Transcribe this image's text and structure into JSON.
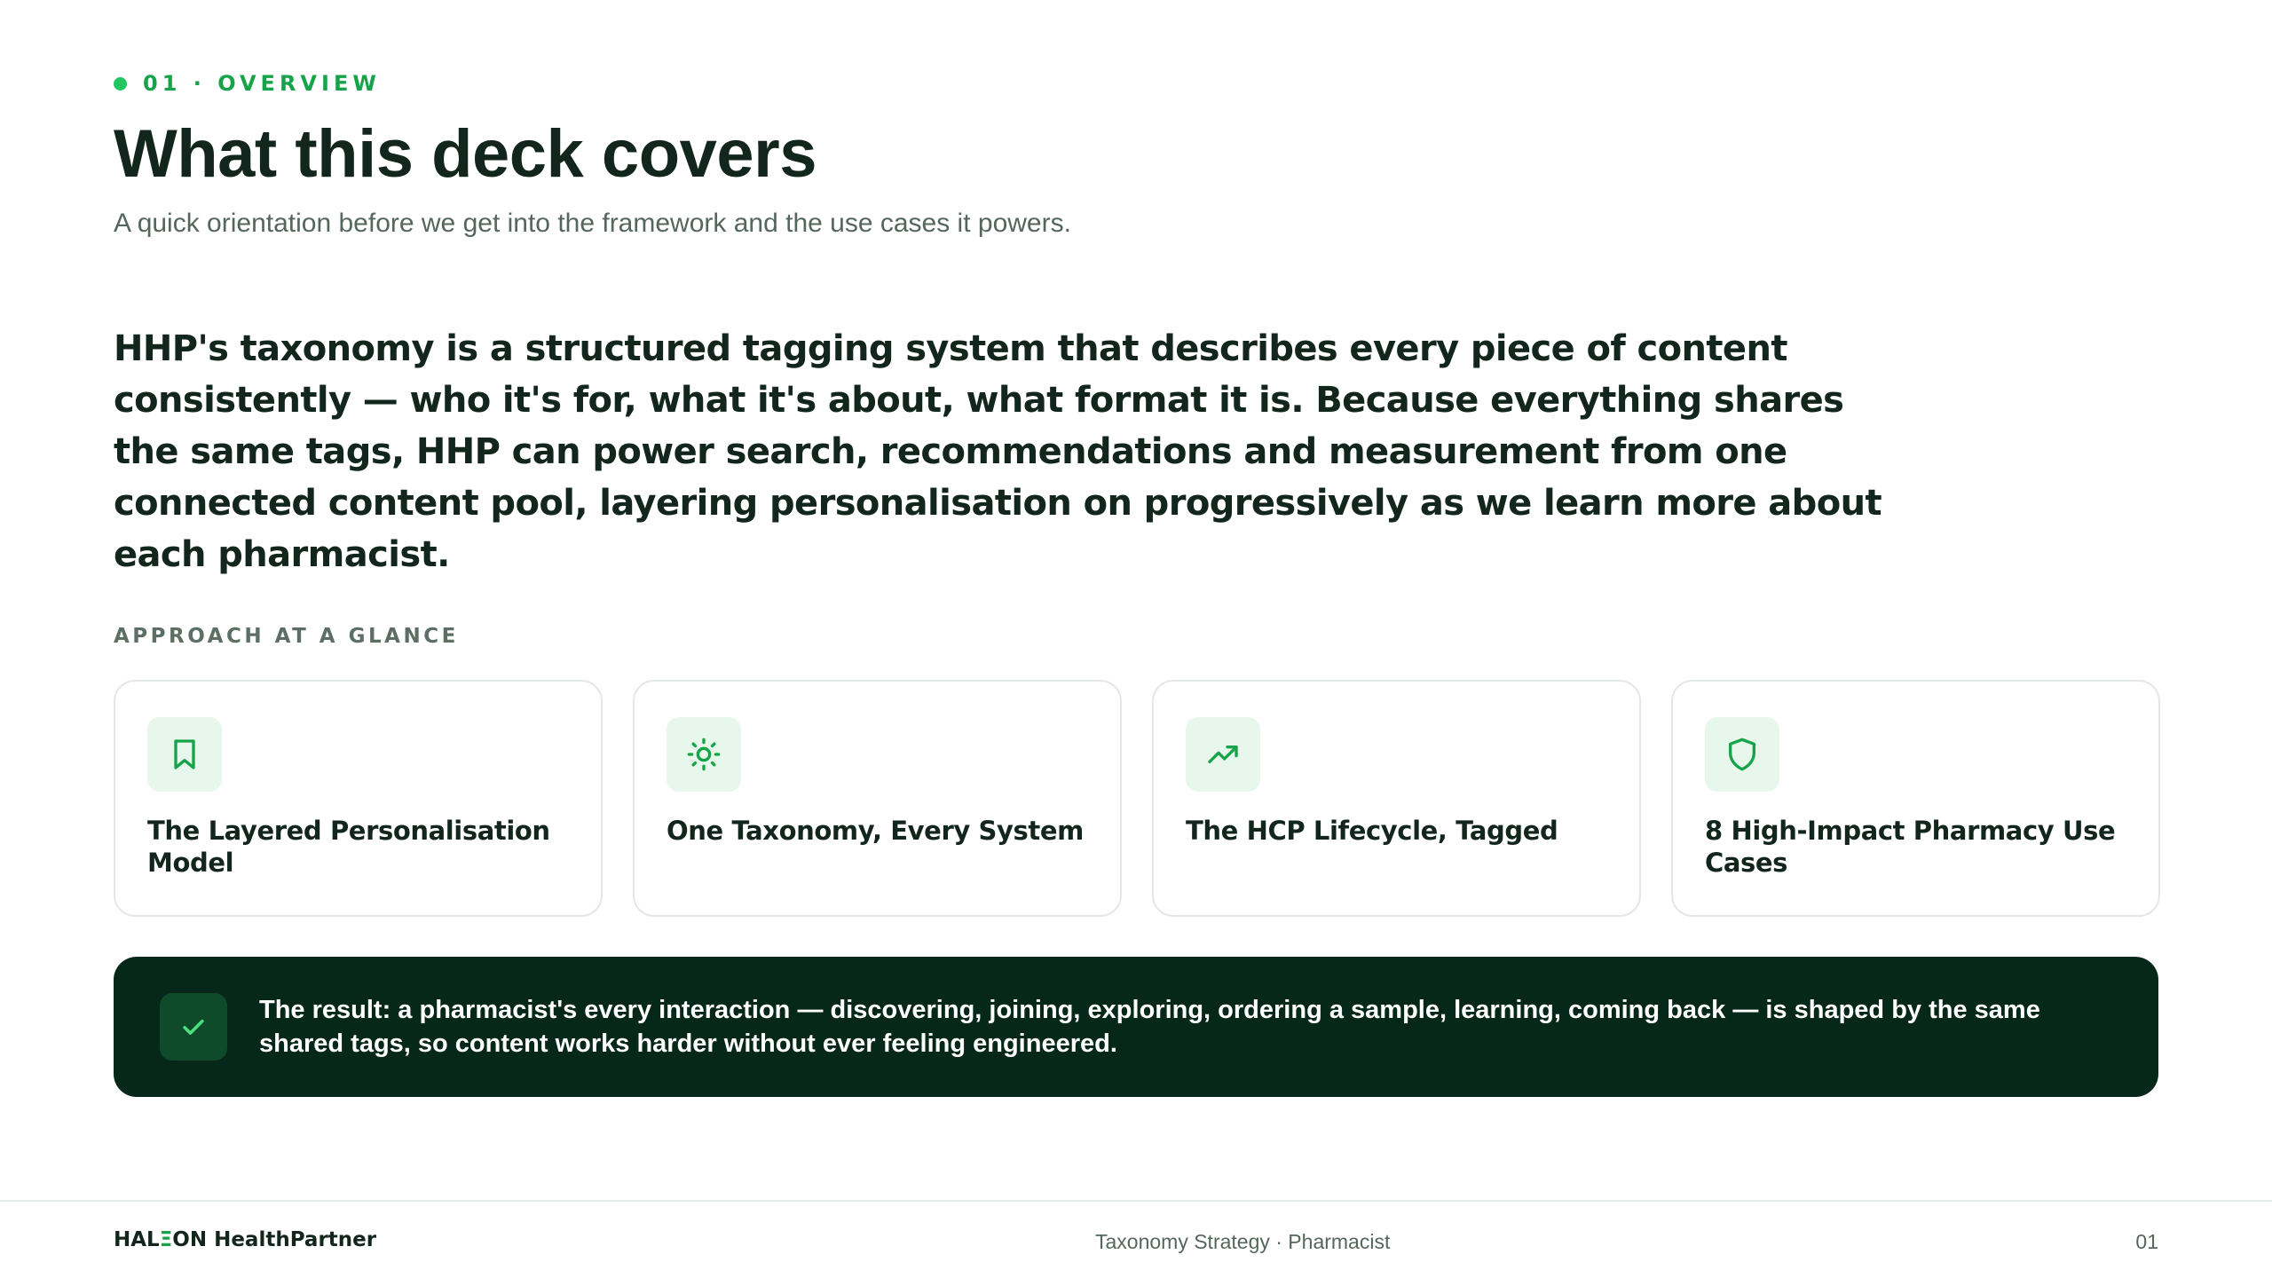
{
  "header": {
    "eyebrow": "01 · OVERVIEW",
    "title": "What this deck covers",
    "subtitle": "A quick orientation before we get into the framework and the use cases it powers."
  },
  "lead": "HHP's taxonomy is a structured tagging system that describes every piece of content consistently — who it's for, what it's about, what format it is. Because everything shares the same tags, HHP can power search, recommendations and measurement from one connected content pool, layering personalisation on progressively as we learn more about each pharmacist.",
  "approach": {
    "label": "APPROACH AT A GLANCE",
    "cards": [
      {
        "title": "The Layered Personalisation Model",
        "icon": "bookmark-icon"
      },
      {
        "title": "One Taxonomy, Every System",
        "icon": "sun-icon"
      },
      {
        "title": "The HCP Lifecycle, Tagged",
        "icon": "trending-up-icon"
      },
      {
        "title": "8 High-Impact Pharmacy Use Cases",
        "icon": "shield-icon"
      }
    ]
  },
  "result": {
    "icon": "check-icon",
    "text": "The result: a pharmacist's every interaction — discovering, joining, exploring, ordering a sample, learning, coming back — is shaped by the same shared tags, so content works harder without ever feeling engineered."
  },
  "footer": {
    "brand_prefix": "HAL",
    "brand_mark": "Ξ",
    "brand_suffix": "ON HealthPartner",
    "center": "Taxonomy Strategy · Pharmacist",
    "page": "01"
  },
  "colors": {
    "accent": "#16a34a",
    "dark_panel": "#06281a",
    "icon_bg": "#e7f7eb"
  }
}
